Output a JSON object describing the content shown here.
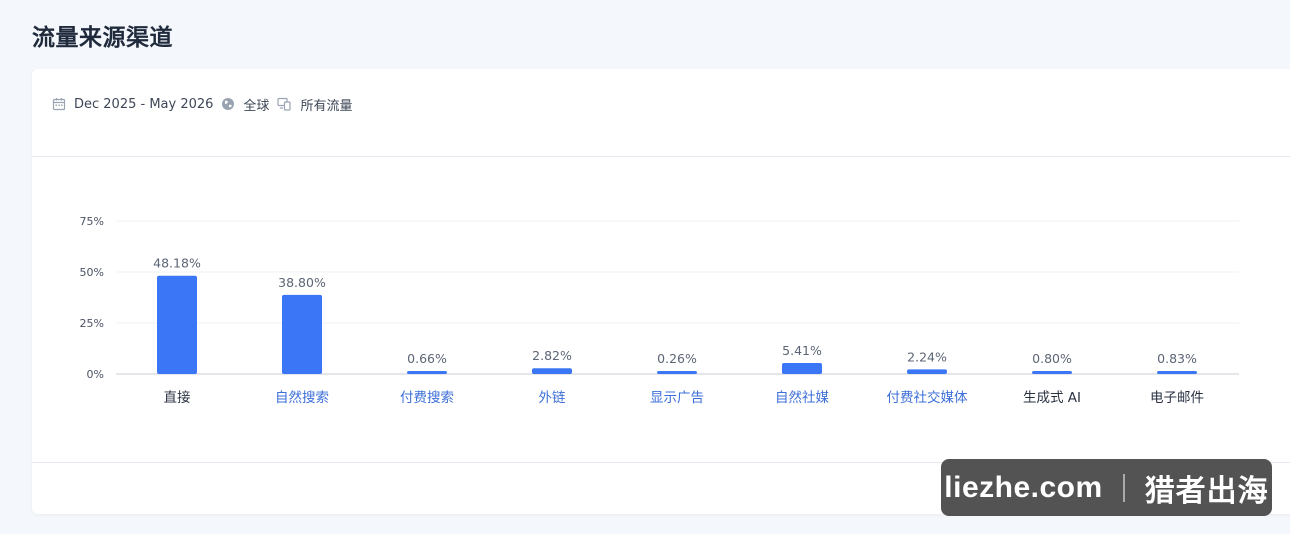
{
  "page": {
    "title": "流量来源渠道"
  },
  "filters": {
    "date_range": "Dec 2025 - May 2026",
    "region": "全球",
    "traffic_type": "所有流量"
  },
  "colors": {
    "bar": "#3b76f6",
    "link_label": "#3d6fd8",
    "plain_label": "#2a3242",
    "value_label": "#5c6575",
    "grid": "#eef0f4",
    "axis": "#c8ccd4"
  },
  "chart_data": {
    "type": "bar",
    "categories": [
      "直接",
      "自然搜索",
      "付费搜索",
      "外链",
      "显示广告",
      "自然社媒",
      "付费社交媒体",
      "生成式 AI",
      "电子邮件"
    ],
    "category_is_link": [
      false,
      true,
      true,
      true,
      true,
      true,
      true,
      false,
      false
    ],
    "values": [
      48.18,
      38.8,
      0.66,
      2.82,
      0.26,
      5.41,
      2.24,
      0.8,
      0.83
    ],
    "value_labels": [
      "48.18%",
      "38.80%",
      "0.66%",
      "2.82%",
      "0.26%",
      "5.41%",
      "2.24%",
      "0.80%",
      "0.83%"
    ],
    "yticks": [
      0,
      25,
      50,
      75
    ],
    "ytick_labels": [
      "0%",
      "25%",
      "50%",
      "75%"
    ],
    "ylim": [
      0,
      75
    ],
    "grid": true,
    "title": "",
    "xlabel": "",
    "ylabel": ""
  },
  "watermark": {
    "left": "liezhe.com",
    "right": "猎者出海"
  }
}
